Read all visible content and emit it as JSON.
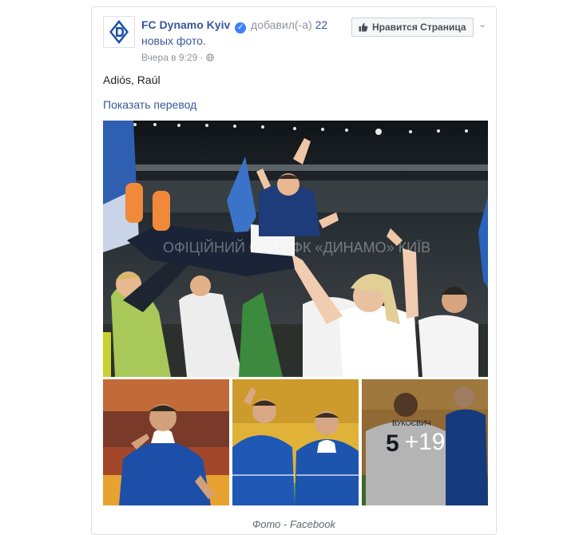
{
  "post": {
    "page_name": "FC Dynamo Kyiv",
    "action_text": "добавил(-а)",
    "photo_count": "22",
    "photo_suffix": "новых фото.",
    "timestamp": "Вчера в 9:29",
    "privacy_icon": "globe-icon",
    "like_button": "Нравится Страница",
    "text": "Adiós, Raúl",
    "translate_link": "Показать перевод",
    "watermark": "ОФІЦІЙНИЙ САЙТ ФК «ДИНАМО» КИЇВ",
    "more_photos": "+19",
    "jersey_name": "ВУКОЄВИЧ",
    "jersey_number": "5"
  },
  "caption": "Фото - Facebook",
  "colors": {
    "link": "#365899",
    "muted": "#90949c",
    "club_blue": "#1a4fa3"
  }
}
